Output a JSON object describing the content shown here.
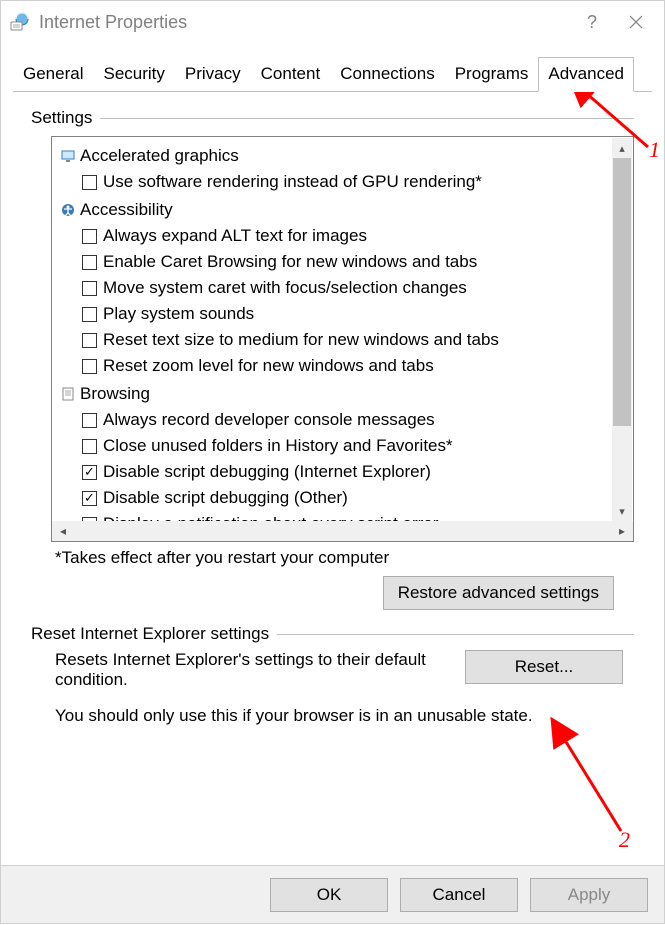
{
  "window": {
    "title": "Internet Properties",
    "help_glyph": "?",
    "close_glyph": "×"
  },
  "tabs": [
    {
      "label": "General",
      "active": false
    },
    {
      "label": "Security",
      "active": false
    },
    {
      "label": "Privacy",
      "active": false
    },
    {
      "label": "Content",
      "active": false
    },
    {
      "label": "Connections",
      "active": false
    },
    {
      "label": "Programs",
      "active": false
    },
    {
      "label": "Advanced",
      "active": true
    }
  ],
  "settings_label": "Settings",
  "groups": [
    {
      "icon": "monitor-icon",
      "label": "Accelerated graphics",
      "items": [
        {
          "checked": false,
          "label": "Use software rendering instead of GPU rendering*"
        }
      ]
    },
    {
      "icon": "accessibility-icon",
      "label": "Accessibility",
      "items": [
        {
          "checked": false,
          "label": "Always expand ALT text for images"
        },
        {
          "checked": false,
          "label": "Enable Caret Browsing for new windows and tabs"
        },
        {
          "checked": false,
          "label": "Move system caret with focus/selection changes"
        },
        {
          "checked": false,
          "label": "Play system sounds"
        },
        {
          "checked": false,
          "label": "Reset text size to medium for new windows and tabs"
        },
        {
          "checked": false,
          "label": "Reset zoom level for new windows and tabs"
        }
      ]
    },
    {
      "icon": "page-icon",
      "label": "Browsing",
      "items": [
        {
          "checked": false,
          "label": "Always record developer console messages"
        },
        {
          "checked": false,
          "label": "Close unused folders in History and Favorites*"
        },
        {
          "checked": true,
          "label": "Disable script debugging (Internet Explorer)"
        },
        {
          "checked": true,
          "label": "Disable script debugging (Other)"
        },
        {
          "checked": false,
          "label": "Display a notification about every script error"
        }
      ]
    }
  ],
  "note": "*Takes effect after you restart your computer",
  "restore_label": "Restore advanced settings",
  "reset_section_label": "Reset Internet Explorer settings",
  "reset_text": "Resets Internet Explorer's settings to their default condition.",
  "reset_button": "Reset...",
  "warn_text": "You should only use this if your browser is in an unusable state.",
  "buttons": {
    "ok": "OK",
    "cancel": "Cancel",
    "apply": "Apply"
  },
  "annotations": {
    "a1": "1",
    "a2": "2"
  }
}
